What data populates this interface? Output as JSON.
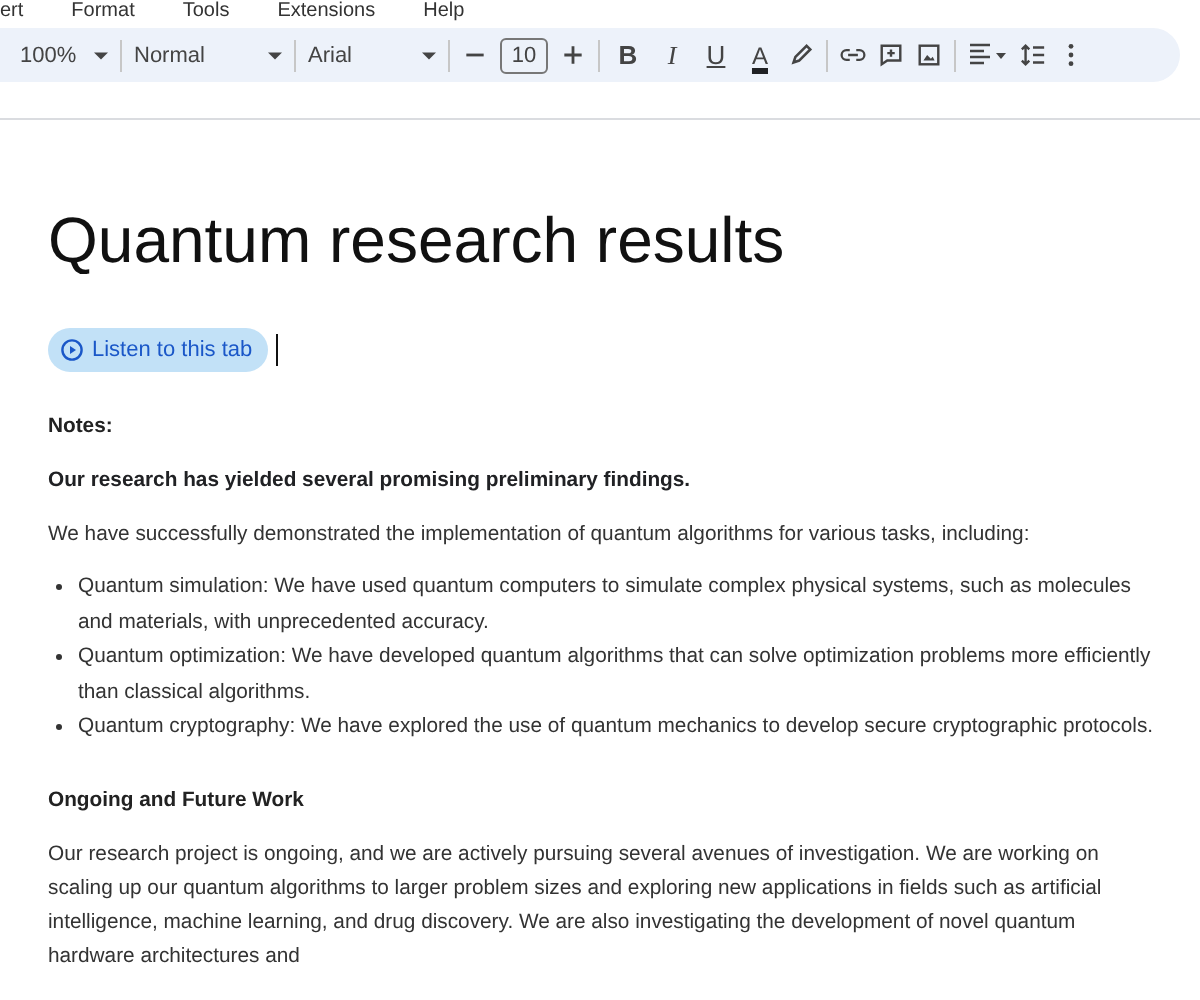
{
  "menu": [
    "ert",
    "Format",
    "Tools",
    "Extensions",
    "Help"
  ],
  "toolbar": {
    "zoom": "100%",
    "style": "Normal",
    "font": "Arial",
    "font_size": "10",
    "format_buttons": [
      {
        "label": "B",
        "kind": "bold"
      },
      {
        "label": "I",
        "kind": "italic"
      },
      {
        "label": "U",
        "kind": "underline"
      },
      {
        "label": "A",
        "kind": "color"
      }
    ]
  },
  "document": {
    "title": "Quantum research results",
    "listen_chip": "Listen to this tab",
    "blocks": [
      {
        "kind": "heading",
        "text": "Notes:"
      },
      {
        "kind": "bold",
        "text": "Our research has yielded several promising preliminary findings."
      },
      {
        "kind": "paragraph",
        "text": "We have successfully demonstrated the implementation of quantum algorithms for various tasks, including:"
      },
      {
        "kind": "list",
        "items": [
          "Quantum simulation: We have used quantum computers to simulate complex physical systems, such as molecules and materials, with unprecedented accuracy.",
          "Quantum optimization: We have developed quantum algorithms that can solve optimization problems more efficiently than classical algorithms.",
          "Quantum cryptography: We have explored the use of quantum mechanics to develop secure cryptographic protocols."
        ]
      },
      {
        "kind": "heading",
        "text": "Ongoing and Future Work"
      },
      {
        "kind": "paragraph",
        "text": "Our research project is ongoing, and we are actively pursuing several avenues of investigation. We are working on scaling up our quantum algorithms to larger problem sizes and exploring new applications in fields such as artificial intelligence, machine learning, and drug discovery. We are also investigating the development of novel quantum hardware architectures and"
      }
    ]
  }
}
